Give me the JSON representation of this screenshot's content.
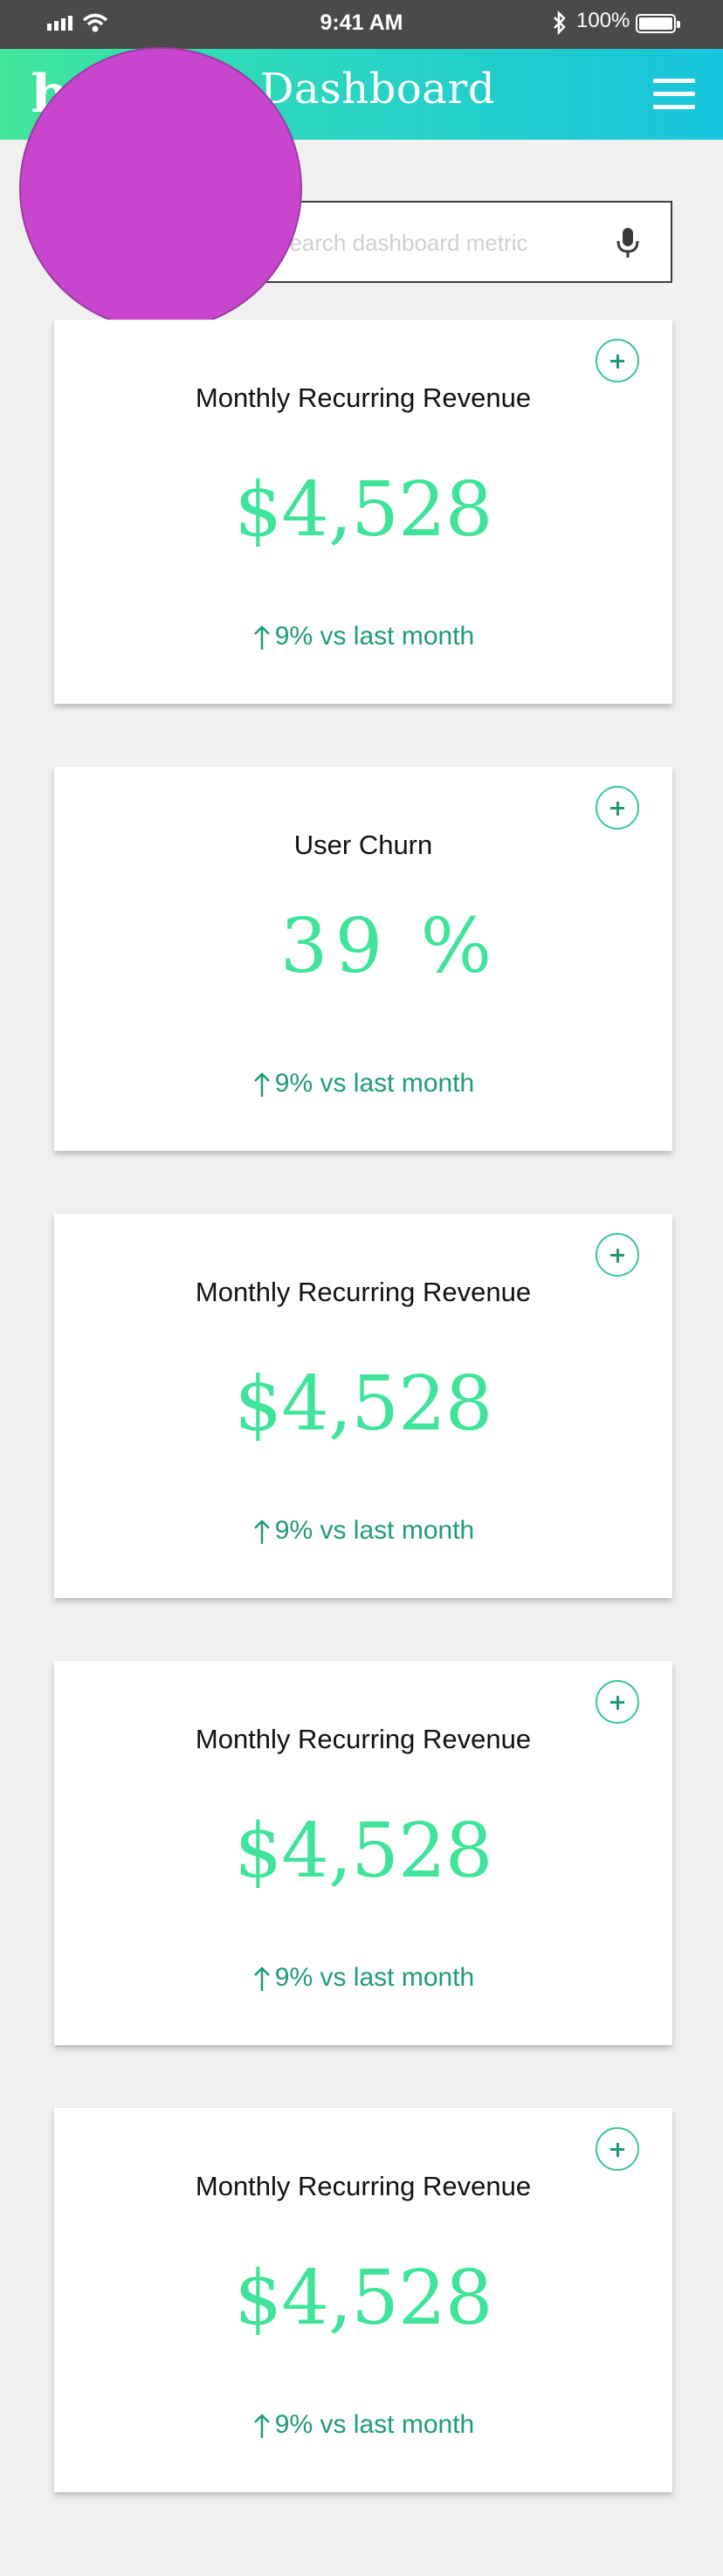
{
  "status_bar": {
    "time": "9:41 AM",
    "battery": "100%",
    "icons": [
      "signal-icon",
      "wifi-icon",
      "bluetooth-icon",
      "battery-icon"
    ]
  },
  "header": {
    "logo": "b",
    "title": "Dashboard",
    "menu_icon": "hamburger-menu-icon"
  },
  "search": {
    "placeholder": "Search dashboard metric",
    "mic_icon": "microphone-icon"
  },
  "colors": {
    "accent": "#3fe39a",
    "trend": "#1f9d72",
    "avatar": "#c845cd",
    "header_from": "#41e69a",
    "header_to": "#18c4dc"
  },
  "cards": [
    {
      "title": "Monthly Recurring Revenue",
      "value": "$4,528",
      "trend": "9% vs last month"
    },
    {
      "title": "User Churn",
      "value": "39 %",
      "trend": "9% vs last month"
    },
    {
      "title": "Monthly Recurring Revenue",
      "value": "$4,528",
      "trend": "9% vs last month"
    },
    {
      "title": "Monthly Recurring Revenue",
      "value": "$4,528",
      "trend": "9% vs last month"
    },
    {
      "title": "Monthly Recurring Revenue",
      "value": "$4,528",
      "trend": "9% vs last month"
    }
  ]
}
